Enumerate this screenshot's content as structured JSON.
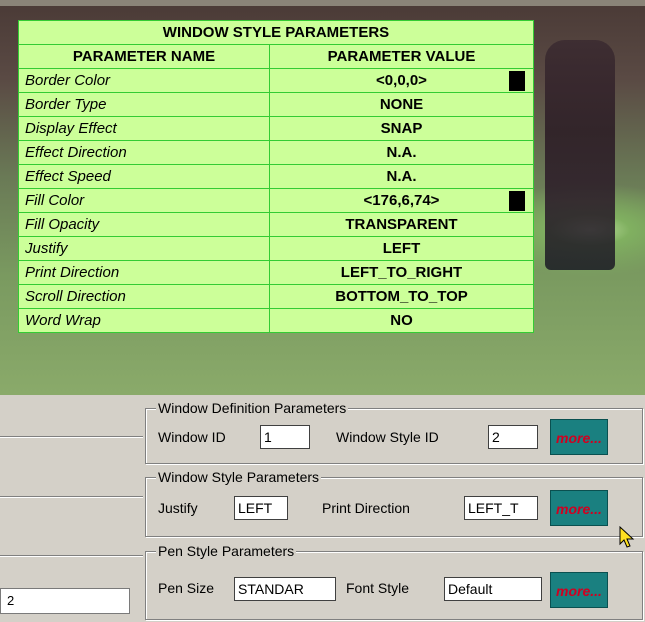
{
  "table": {
    "title": "WINDOW STYLE PARAMETERS",
    "headers": [
      "PARAMETER NAME",
      "PARAMETER VALUE"
    ],
    "rows": [
      {
        "name": "Border Color",
        "value": "<0,0,0>",
        "swatch": "#000000"
      },
      {
        "name": "Border Type",
        "value": "NONE"
      },
      {
        "name": "Display Effect",
        "value": "SNAP"
      },
      {
        "name": "Effect Direction",
        "value": "N.A."
      },
      {
        "name": "Effect Speed",
        "value": "N.A."
      },
      {
        "name": "Fill Color",
        "value": "<176,6,74>",
        "swatch": "#000000"
      },
      {
        "name": "Fill Opacity",
        "value": "TRANSPARENT"
      },
      {
        "name": "Justify",
        "value": "LEFT"
      },
      {
        "name": "Print Direction",
        "value": "LEFT_TO_RIGHT"
      },
      {
        "name": "Scroll Direction",
        "value": "BOTTOM_TO_TOP"
      },
      {
        "name": "Word Wrap",
        "value": "NO"
      }
    ]
  },
  "left_panel": {
    "input_value": "2"
  },
  "window_definition": {
    "legend": "Window Definition Parameters",
    "window_id_label": "Window ID",
    "window_id_value": "1",
    "window_style_id_label": "Window Style ID",
    "window_style_id_value": "2",
    "more_label": "more..."
  },
  "window_style": {
    "legend": "Window Style Parameters",
    "justify_label": "Justify",
    "justify_value": "LEFT",
    "print_direction_label": "Print Direction",
    "print_direction_value": "LEFT_T",
    "more_label": "more..."
  },
  "pen_style": {
    "legend": "Pen Style Parameters",
    "pen_size_label": "Pen Size",
    "pen_size_value": "STANDAR",
    "font_style_label": "Font Style",
    "font_style_value": "Default",
    "more_label": "more..."
  },
  "colors": {
    "table_bg": "#ccff99",
    "table_border": "#33cc33",
    "more_bg": "#1a8080",
    "more_text": "#d00020"
  }
}
